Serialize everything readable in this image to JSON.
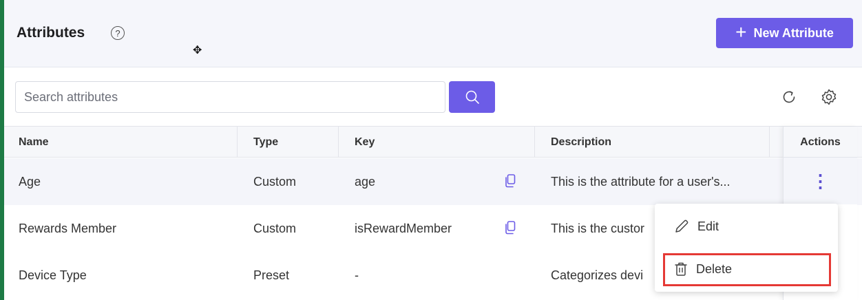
{
  "header": {
    "title": "Attributes",
    "help_glyph": "?",
    "new_button_label": "New Attribute"
  },
  "search": {
    "placeholder": "Search attributes",
    "value": ""
  },
  "table": {
    "columns": {
      "name": "Name",
      "type": "Type",
      "key": "Key",
      "description": "Description",
      "actions": "Actions"
    },
    "rows": [
      {
        "name": "Age",
        "type": "Custom",
        "key": "age",
        "description": "This is the attribute for a user's..."
      },
      {
        "name": "Rewards Member",
        "type": "Custom",
        "key": "isRewardMember",
        "description": "This is the custor"
      },
      {
        "name": "Device Type",
        "type": "Preset",
        "key": "-",
        "description": "Categorizes devi"
      }
    ]
  },
  "menu": {
    "edit_label": "Edit",
    "delete_label": "Delete"
  },
  "colors": {
    "accent": "#6c5ce7",
    "highlight": "#e53935",
    "stripe": "#1e7b45"
  },
  "icons": [
    "help-icon",
    "plus-icon",
    "search-icon",
    "refresh-icon",
    "settings-icon",
    "copy-icon",
    "kebab-icon",
    "edit-icon",
    "trash-icon",
    "move-cursor-icon"
  ]
}
